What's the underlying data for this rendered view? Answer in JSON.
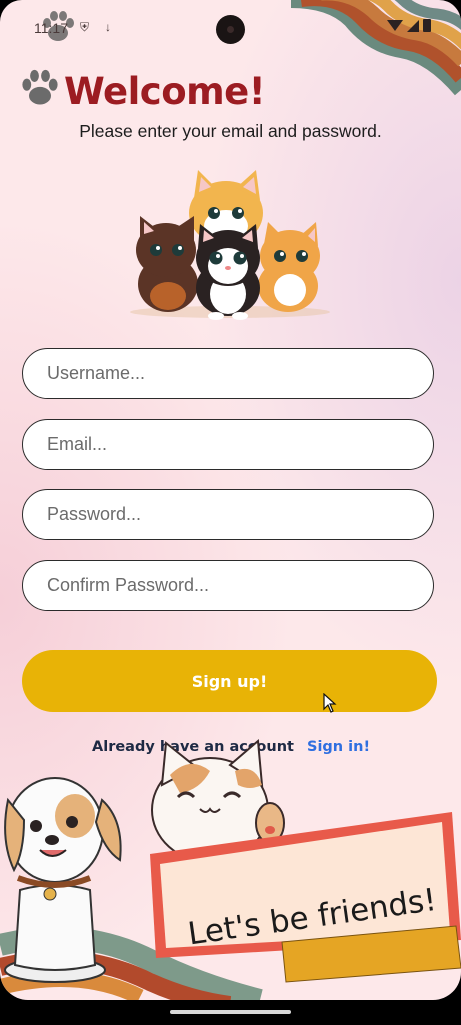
{
  "status_bar": {
    "time": "11:17",
    "icons": [
      "shield-icon",
      "download-icon",
      "wifi-icon",
      "signal-icon",
      "battery-icon"
    ]
  },
  "header": {
    "title": "Welcome!",
    "subtitle": "Please enter your email and password."
  },
  "form": {
    "username_placeholder": "Username...",
    "email_placeholder": "Email...",
    "password_placeholder": "Password...",
    "confirm_password_placeholder": "Confirm Password...",
    "submit_label": "Sign up!"
  },
  "footer": {
    "already_text": "Already have an account",
    "signin_link": "Sign in!"
  },
  "banner": {
    "text": "Let's be friends!"
  },
  "colors": {
    "title": "#9c1c22",
    "button": "#e8b306",
    "link": "#2f6fe0",
    "background": "#fde8ea"
  }
}
